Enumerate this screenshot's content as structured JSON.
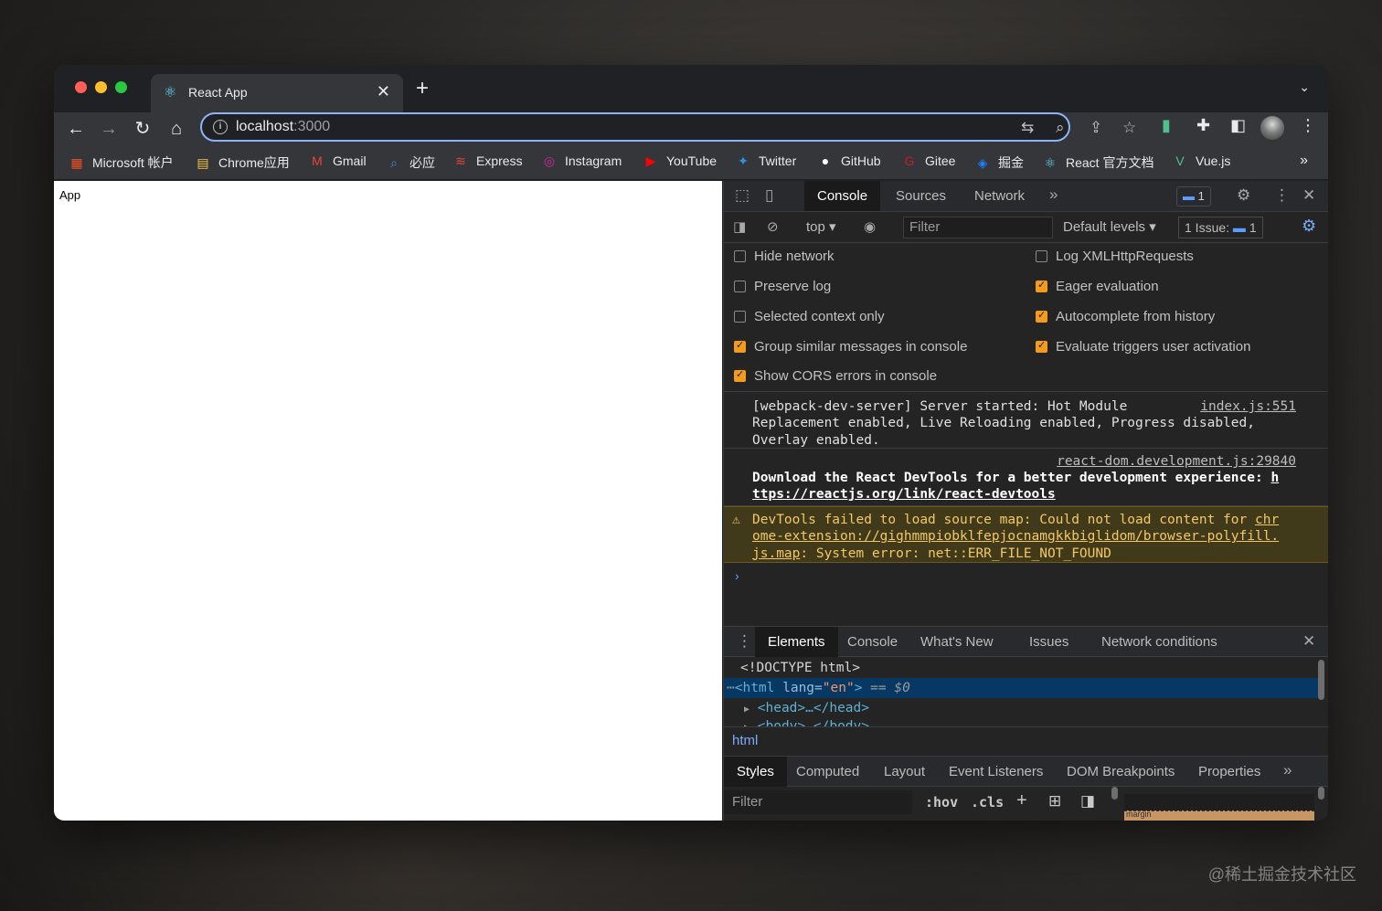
{
  "browser": {
    "tab": {
      "title": "React App"
    },
    "omnibox": {
      "host": "localhost",
      "port": ":3000"
    },
    "bookmarks": [
      {
        "label": "Microsoft 帐户",
        "icon": "microsoft-icon"
      },
      {
        "label": "Chrome应用",
        "icon": "chrome-apps-icon"
      },
      {
        "label": "Gmail",
        "icon": "gmail-icon"
      },
      {
        "label": "必应",
        "icon": "bing-search-icon"
      },
      {
        "label": "Express",
        "icon": "express-icon"
      },
      {
        "label": "Instagram",
        "icon": "instagram-icon"
      },
      {
        "label": "YouTube",
        "icon": "youtube-icon"
      },
      {
        "label": "Twitter",
        "icon": "twitter-icon"
      },
      {
        "label": "GitHub",
        "icon": "github-icon"
      },
      {
        "label": "Gitee",
        "icon": "gitee-icon"
      },
      {
        "label": "掘金",
        "icon": "juejin-icon"
      },
      {
        "label": "React 官方文档",
        "icon": "react-icon"
      },
      {
        "label": "Vue.js",
        "icon": "vue-icon"
      }
    ]
  },
  "page": {
    "app_text": "App"
  },
  "devtools": {
    "tabs": [
      "Console",
      "Sources",
      "Network"
    ],
    "issues_badge": "1",
    "console_bar": {
      "context": "top",
      "filter_placeholder": "Filter",
      "levels": "Default levels",
      "issue_label": "1 Issue:",
      "issue_count": "1"
    },
    "settings_left": [
      {
        "label": "Hide network",
        "checked": false
      },
      {
        "label": "Preserve log",
        "checked": false
      },
      {
        "label": "Selected context only",
        "checked": false
      },
      {
        "label": "Group similar messages in console",
        "checked": true
      },
      {
        "label": "Show CORS errors in console",
        "checked": true
      }
    ],
    "settings_right": [
      {
        "label": "Log XMLHttpRequests",
        "checked": false
      },
      {
        "label": "Eager evaluation",
        "checked": true
      },
      {
        "label": "Autocomplete from history",
        "checked": true
      },
      {
        "label": "Evaluate triggers user activation",
        "checked": true
      }
    ],
    "messages": {
      "m1_source": "index.js:551",
      "m1_line1": "[webpack-dev-server] Server started: Hot Module",
      "m1_line2": "Replacement enabled, Live Reloading enabled, Progress disabled,",
      "m1_line3": "Overlay enabled.",
      "m2_source": "react-dom.development.js:29840",
      "m2_line1": "Download the React DevTools for a better development experience: ",
      "m2_link1": "h",
      "m2_link2": "ttps://reactjs.org/link/react-devtools",
      "m3_line1": "DevTools failed to load source map: Could not load content for ",
      "m3_link1": "chr",
      "m3_link2": "ome-extension://gighmmpiobklfepjocnamgkkbiglidom/browser-polyfill.",
      "m3_link3": "js.map",
      "m3_tail": ": System error: net::ERR_FILE_NOT_FOUND",
      "prompt": "›"
    },
    "drawer_tabs": [
      "Elements",
      "Console",
      "What's New",
      "Issues",
      "Network conditions"
    ],
    "dom": {
      "doctype": "<!DOCTYPE html>",
      "html_open": "<html",
      "lang_attr": " lang=",
      "lang_val": "\"en\"",
      "html_close": ">",
      "selected_suffix": " == $0",
      "head": "<head>…</head>",
      "body": "<body>…</body>"
    },
    "breadcrumb": "html",
    "styles_tabs": [
      "Styles",
      "Computed",
      "Layout",
      "Event Listeners",
      "DOM Breakpoints",
      "Properties"
    ],
    "styles_filter_placeholder": "Filter",
    "hov": ":hov",
    "cls": ".cls",
    "box_model_label": "margin"
  },
  "watermark": "@稀土掘金技术社区"
}
